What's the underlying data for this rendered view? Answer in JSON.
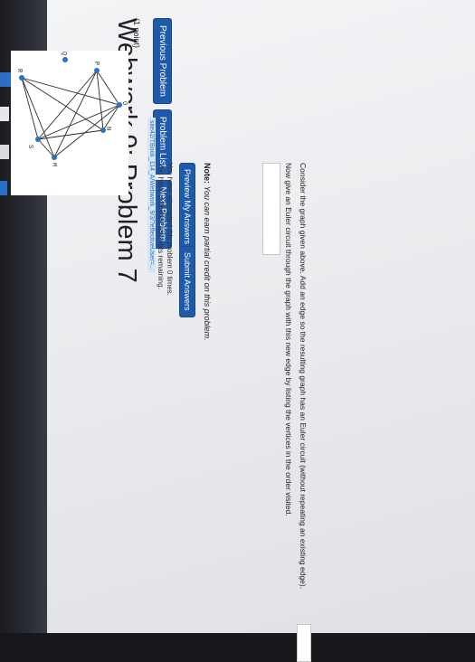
{
  "page_title": "Webwork 9: Problem 7",
  "nav": {
    "previous": "Previous Problem",
    "list": "Problem List",
    "next": "Next Problem"
  },
  "points": "(1 point)",
  "graph": {
    "vertices": [
      "O",
      "N",
      "P",
      "M",
      "Q",
      "R",
      "S"
    ]
  },
  "prompt_1": "Consider the graph given above. Add an edge so the resulting graph has an Euler circuit (without repeating an existing edge).",
  "prompt_2": "Now give an Euler circuit through the graph with this new edge by listing the vertices in the order visited.",
  "note_label": "Note:",
  "note_text": "You can earn partial credit on this problem.",
  "buttons": {
    "preview": "Preview My Answers",
    "submit": "Submit Answers"
  },
  "footer": {
    "attempted": "You have attempted this problem 0 times.",
    "unlimited": "You have unlimited attempts remaining.",
    "url": "site42/TBook_114_A/Webwork_9/3/?effectiveUser=..."
  },
  "colors": {
    "button": "#1e5aa8",
    "vertex": "#2d6fc4"
  }
}
